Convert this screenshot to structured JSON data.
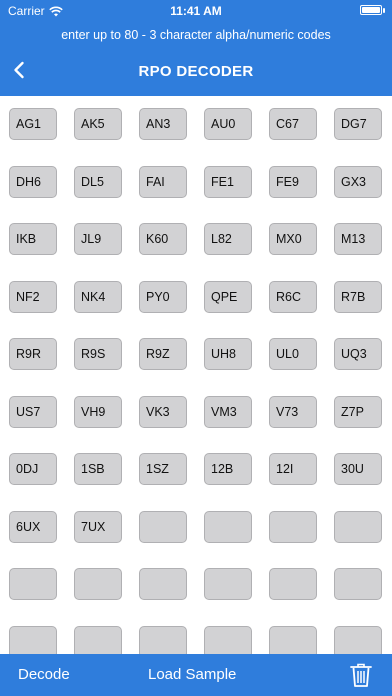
{
  "status": {
    "carrier": "Carrier",
    "time": "11:41 AM",
    "battery_level": 1.0
  },
  "header": {
    "subtitle": "enter up to 80 - 3 character alpha/numeric codes",
    "title": "RPO DECODER",
    "back_icon": "chevron-left-icon"
  },
  "codes": [
    "AG1",
    "AK5",
    "AN3",
    "AU0",
    "C67",
    "DG7",
    "DH6",
    "DL5",
    "FAI",
    "FE1",
    "FE9",
    "GX3",
    "IKB",
    "JL9",
    "K60",
    "L82",
    "MX0",
    "M13",
    "NF2",
    "NK4",
    "PY0",
    "QPE",
    "R6C",
    "R7B",
    "R9R",
    "R9S",
    "R9Z",
    "UH8",
    "UL0",
    "UQ3",
    "US7",
    "VH9",
    "VK3",
    "VM3",
    "V73",
    "Z7P",
    "0DJ",
    "1SB",
    "1SZ",
    "12B",
    "12I",
    "30U",
    "6UX",
    "7UX",
    "",
    "",
    "",
    "",
    "",
    "",
    "",
    "",
    "",
    "",
    "",
    "",
    "",
    "",
    "",
    ""
  ],
  "toolbar": {
    "decode_label": "Decode",
    "load_sample_label": "Load Sample",
    "trash_icon": "trash-icon"
  },
  "colors": {
    "bar": "#2f7ddc",
    "cell": "#d2d2d4"
  }
}
